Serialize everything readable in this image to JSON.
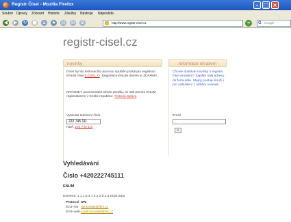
{
  "window": {
    "title": "Registr Čísel - Mozilla Firefox"
  },
  "menu": [
    "Soubor",
    "Úpravy",
    "Zobrazit",
    "Historie",
    "Záložky",
    "Nástroje",
    "Nápověda"
  ],
  "navigation": {
    "url": "http://www.registr-cisel.cz",
    "search_placeholder": "Google"
  },
  "site": {
    "title": "registr-cisel.cz"
  },
  "news": {
    "heading": "novinky",
    "p1_before": "Dnes byl do testovacího provozu spuštěn portál pro registraci ENUM čísel ",
    "p1_link": "E.OZEL.O",
    "p1_after": ". Registrace ENUM domén je ZDARMA.",
    "p2_before": "KRASNET, provozovatel tohoto portálu, se stal prvním ENUM registrátorem v České republice. ",
    "p2_link": "Tisková zpráva",
    "lookup_label": "Vyhledat telefonní číslo",
    "lookup_value": "222 745 111",
    "prefix_label": "např.",
    "prefix_example": "222 745 111"
  },
  "info": {
    "heading": "Informace emailem",
    "text": "Chcete dostávat novinky o registru čísel emailem? Zapište Vaši adresu do formuláře. Stejný postup slouží i pro odhlášení z odběru novinek.",
    "email_label": "Email",
    "submit_label": "»"
  },
  "results": {
    "heading": "Vyhledávání",
    "number_heading": "Číslo +420222745111",
    "enum_heading": "ENUM",
    "domain_label": "Doména",
    "domain_value": "1.1.1.5.4.7.2.2.2.0.2.4.e164.arpa",
    "columns": [
      "Protocol",
      "URI"
    ],
    "rows": [
      [
        "E2U+sip",
        "sip:kontakt@krs.cz"
      ],
      [
        "E2U+web",
        "mailto:kontakt@krs.cz"
      ]
    ]
  }
}
